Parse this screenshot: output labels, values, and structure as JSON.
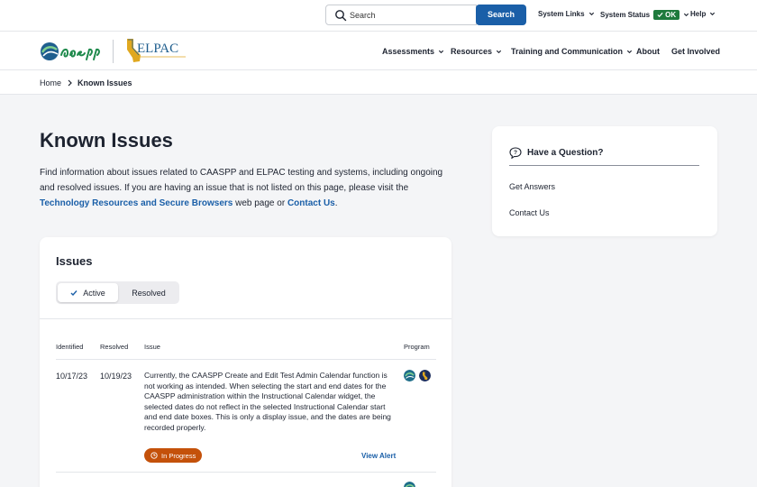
{
  "utility": {
    "search_placeholder": "Search",
    "search_button": "Search",
    "system_links": "System Links",
    "system_status": "System Status",
    "status_ok": "OK",
    "help": "Help"
  },
  "header": {
    "nav": [
      "Assessments",
      "Resources",
      "Training and Communication",
      "About",
      "Get Involved"
    ]
  },
  "breadcrumb": {
    "home": "Home",
    "current": "Known Issues"
  },
  "page": {
    "title": "Known Issues",
    "intro_1": "Find information about issues related to CAASPP and ELPAC testing and systems, including ongoing and resolved issues. If you are having an issue that is not listed on this page, please visit the ",
    "intro_link_1": "Technology Resources and Secure Browsers",
    "intro_2": " web page or ",
    "intro_link_2": "Contact Us",
    "intro_3": "."
  },
  "issues": {
    "title": "Issues",
    "tab_active": "Active",
    "tab_resolved": "Resolved",
    "columns": [
      "Identified",
      "Resolved",
      "Issue",
      "Program"
    ],
    "rows": [
      {
        "identified": "10/17/23",
        "resolved": "10/19/23",
        "issue": "Currently, the CAASPP Create and Edit Test Admin Calendar function is not working as intended. When selecting the start and end dates for the CAASPP administration within the Instructional Calendar widget, the selected dates do not reflect in the selected Instructional Calendar start and end date boxes. This is only a display issue, and the dates are being recorded properly.",
        "status": "In Progress",
        "view_alert": "View Alert"
      }
    ]
  },
  "sidebar": {
    "title": "Have a Question?",
    "links": [
      "Get Answers",
      "Contact Us"
    ]
  },
  "colors": {
    "primary": "#1a5fa8",
    "status_ok": "#1e7a3c",
    "in_progress": "#c4510a",
    "caaspp_green": "#1f8a4c",
    "elpac_gold": "#e0a820"
  }
}
